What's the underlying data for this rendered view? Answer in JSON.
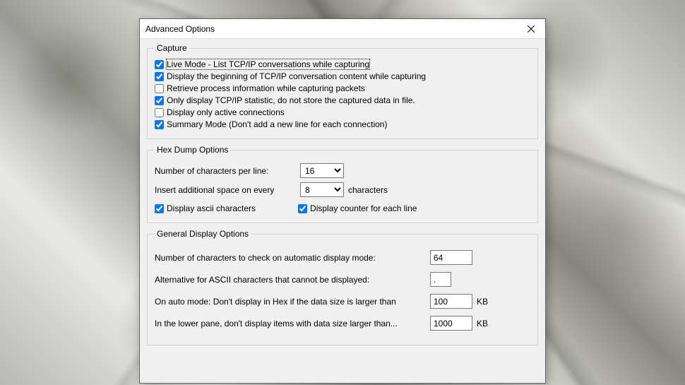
{
  "window": {
    "title": "Advanced Options"
  },
  "capture": {
    "legend": "Capture",
    "items": [
      {
        "label": "Live Mode - List TCP/IP conversations while capturing",
        "checked": true,
        "focused": true
      },
      {
        "label": "Display the beginning of TCP/IP conversation content while capturing",
        "checked": true,
        "focused": false
      },
      {
        "label": "Retrieve process information while capturing packets",
        "checked": false,
        "focused": false
      },
      {
        "label": "Only display TCP/IP statistic, do not store the captured data in file.",
        "checked": true,
        "focused": false
      },
      {
        "label": "Display only active connections",
        "checked": false,
        "focused": false
      },
      {
        "label": "Summary Mode (Don't add a new line for each connection)",
        "checked": true,
        "focused": false
      }
    ]
  },
  "hex": {
    "legend": "Hex Dump Options",
    "chars_per_line_label": "Number of characters per line:",
    "chars_per_line_value": "16",
    "insert_space_label": "Insert additional space on every",
    "insert_space_value": "8",
    "insert_space_suffix": "characters",
    "display_ascii_label": "Display ascii characters",
    "display_ascii_checked": true,
    "display_counter_label": "Display counter for each line",
    "display_counter_checked": true
  },
  "general": {
    "legend": "General Display Options",
    "num_chars_label": "Number of characters to check on automatic display mode:",
    "num_chars_value": "64",
    "ascii_alt_label": "Alternative for ASCII characters that cannot be displayed:",
    "ascii_alt_value": ".",
    "auto_mode_label": "On auto mode: Don't display in Hex if the data size is larger than",
    "auto_mode_value": "100",
    "auto_mode_unit": "KB",
    "lower_pane_label": "In the lower pane, don't display items with data size larger than...",
    "lower_pane_value": "1000",
    "lower_pane_unit": "KB"
  }
}
